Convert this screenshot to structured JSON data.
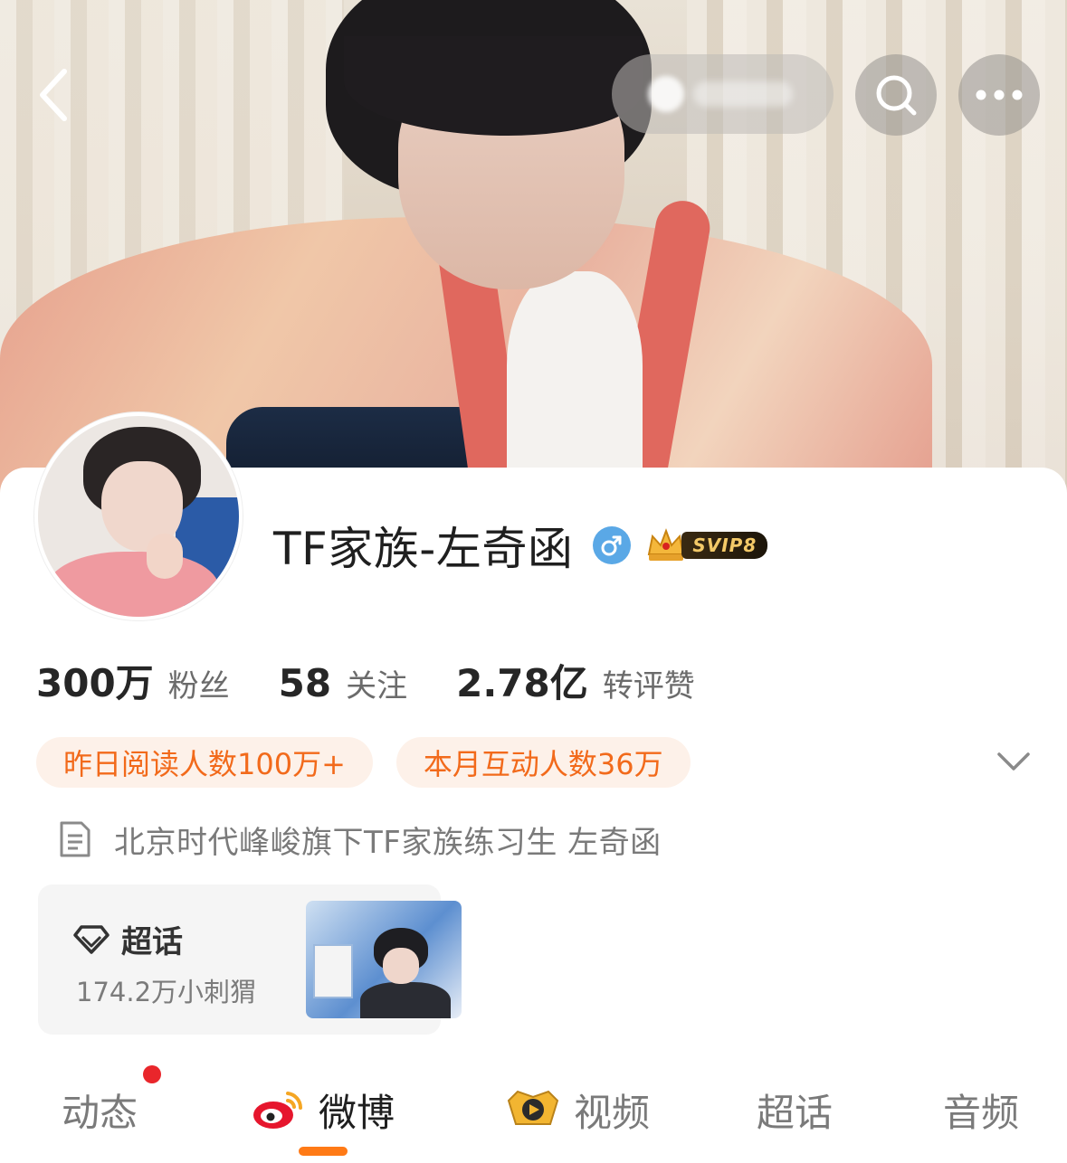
{
  "nav": {
    "back_icon": "chevron-left-icon",
    "search_icon": "search-icon",
    "more_icon": "more-horizontal-icon"
  },
  "profile": {
    "name": "TF家族-左奇函",
    "gender_symbol": "♂",
    "vip_badge": "SVIP8"
  },
  "stats": [
    {
      "value": "300万",
      "label": "粉丝"
    },
    {
      "value": "58",
      "label": "关注"
    },
    {
      "value": "2.78亿",
      "label": "转评赞"
    }
  ],
  "chips": [
    {
      "label": "昨日阅读人数100万+"
    },
    {
      "label": "本月互动人数36万"
    }
  ],
  "bio": {
    "text": "北京时代峰峻旗下TF家族练习生  左奇函"
  },
  "super_topic": {
    "title": "超话",
    "subtitle": "174.2万小刺猬"
  },
  "tabs": [
    {
      "label": "动态",
      "has_dot": true
    },
    {
      "label": "微博",
      "active": true
    },
    {
      "label": "视频"
    },
    {
      "label": "超话"
    },
    {
      "label": "音频"
    }
  ],
  "colors": {
    "accent": "#ff7a16",
    "chip_text": "#f26a1b",
    "chip_bg": "#fdf1e9",
    "notification_dot": "#e9262b",
    "gender_blue": "#5aa8e6"
  }
}
